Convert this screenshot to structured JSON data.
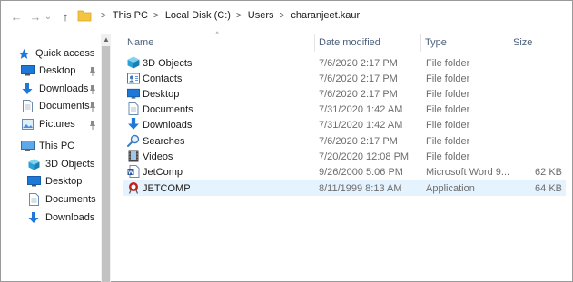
{
  "window": {
    "breadcrumb": [
      "This PC",
      "Local Disk (C:)",
      "Users",
      "charanjeet.kaur"
    ]
  },
  "nav": {
    "back_glyph": "←",
    "forward_glyph": "→",
    "recent_glyph": "⌄",
    "up_glyph": "↑",
    "sep_glyph": ">"
  },
  "navpane": {
    "quick_access": "Quick access",
    "quick_items": [
      {
        "label": "Desktop",
        "icon": "desktop-icon"
      },
      {
        "label": "Downloads",
        "icon": "download-arrow-icon"
      },
      {
        "label": "Documents",
        "icon": "documents-icon"
      },
      {
        "label": "Pictures",
        "icon": "pictures-icon"
      }
    ],
    "this_pc": "This PC",
    "pc_items": [
      {
        "label": "3D Objects",
        "icon": "3d-objects-icon"
      },
      {
        "label": "Desktop",
        "icon": "desktop-icon"
      },
      {
        "label": "Documents",
        "icon": "documents-icon"
      },
      {
        "label": "Downloads",
        "icon": "download-arrow-icon"
      }
    ]
  },
  "columns": {
    "name": "Name",
    "date": "Date modified",
    "type": "Type",
    "size": "Size"
  },
  "files": [
    {
      "name": "3D Objects",
      "date": "7/6/2020 2:17 PM",
      "type": "File folder",
      "size": "",
      "icon": "3d-objects-icon"
    },
    {
      "name": "Contacts",
      "date": "7/6/2020 2:17 PM",
      "type": "File folder",
      "size": "",
      "icon": "contacts-icon"
    },
    {
      "name": "Desktop",
      "date": "7/6/2020 2:17 PM",
      "type": "File folder",
      "size": "",
      "icon": "desktop-icon"
    },
    {
      "name": "Documents",
      "date": "7/31/2020 1:42 AM",
      "type": "File folder",
      "size": "",
      "icon": "documents-icon"
    },
    {
      "name": "Downloads",
      "date": "7/31/2020 1:42 AM",
      "type": "File folder",
      "size": "",
      "icon": "download-arrow-icon"
    },
    {
      "name": "Searches",
      "date": "7/6/2020 2:17 PM",
      "type": "File folder",
      "size": "",
      "icon": "search-icon"
    },
    {
      "name": "Videos",
      "date": "7/20/2020 12:08 PM",
      "type": "File folder",
      "size": "",
      "icon": "videos-icon"
    },
    {
      "name": "JetComp",
      "date": "9/26/2000 5:06 PM",
      "type": "Microsoft Word 9...",
      "size": "62 KB",
      "icon": "word-document-icon"
    },
    {
      "name": "JETCOMP",
      "date": "8/11/1999 8:13 AM",
      "type": "Application",
      "size": "64 KB",
      "icon": "application-icon",
      "selected": true
    }
  ],
  "colors": {
    "selection": "#e5f3ff",
    "header_text": "#4c607a",
    "folder_yellow": "#f4c542",
    "accent_blue": "#1e78d7"
  }
}
